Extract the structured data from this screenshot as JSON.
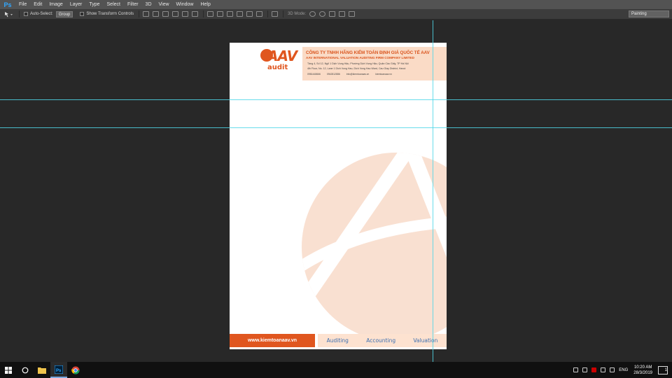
{
  "app": {
    "logo": "Ps"
  },
  "menu": [
    "File",
    "Edit",
    "Image",
    "Layer",
    "Type",
    "Select",
    "Filter",
    "3D",
    "View",
    "Window",
    "Help"
  ],
  "options": {
    "auto_select_label": "Auto-Select:",
    "group_value": "Group",
    "transform_label": "Show Transform Controls",
    "mode_3d_label": "3D Mode:",
    "workspace": "Painting"
  },
  "document": {
    "logo_main": "AAV",
    "logo_sub": "audit",
    "company_vi": "CÔNG TY TNHH HÃNG KIỂM TOÁN ĐỊNH GIÁ QUỐC TẾ AAV",
    "company_en": "AAV INTERNATIONAL VALUATION AUDITING FIRM COMPANY LIMITED",
    "address_vi": "Tầng 4, Số 12, Ngõ 1 Dịch Vọng Hậu, Phường Dịch Vọng Hậu, Quận Cầu Giấy, TP Hà Nội",
    "address_en": "4th Floor, No. 12, Lane 1 Dich Vong Hau, Dich Vong Hau Ward, Cau Giay District, Hanoi",
    "contacts": [
      "0981448666",
      "0942812886",
      "Info@kiemtoanaav.vn",
      "kiemtoanaav.vn"
    ],
    "website": "www.kiemtoanaav.vn",
    "services": [
      "Auditing",
      "Accounting",
      "Valuation"
    ],
    "colors": {
      "brand_orange": "#e0561f",
      "peach": "#fadbc6",
      "blue": "#3d6fb0"
    }
  },
  "taskbar": {
    "lang": "ENG",
    "time": "10:20 AM",
    "date": "28/3/2019",
    "notif_count": "1"
  }
}
